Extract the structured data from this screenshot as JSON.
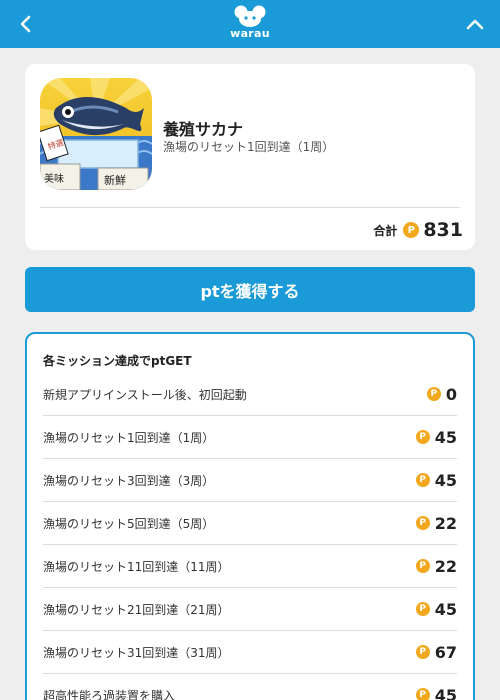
{
  "header": {
    "logo_text": "warau",
    "back_icon": "chevron-left-icon",
    "collapse_icon": "chevron-up-icon"
  },
  "app": {
    "name": "養殖サカナ",
    "subtitle": "漁場のリセット1回到達（1周）",
    "total_label": "合計",
    "total_points": "831",
    "icon_text": [
      "特選",
      "美味",
      "新鮮"
    ]
  },
  "cta": {
    "label": "ptを獲得する"
  },
  "missions": {
    "title": "各ミッション達成でptGET",
    "items": [
      {
        "name": "新規アプリインストール後、初回起動",
        "points": "0"
      },
      {
        "name": "漁場のリセット1回到達（1周）",
        "points": "45"
      },
      {
        "name": "漁場のリセット3回到達（3周）",
        "points": "45"
      },
      {
        "name": "漁場のリセット5回到達（5周）",
        "points": "22"
      },
      {
        "name": "漁場のリセット11回到達（11周）",
        "points": "22"
      },
      {
        "name": "漁場のリセット21回到達（21周）",
        "points": "45"
      },
      {
        "name": "漁場のリセット31回到達（31周）",
        "points": "67"
      },
      {
        "name": "超高性能ろ過装置を購入",
        "points": "45"
      }
    ]
  },
  "coin_symbol": "P",
  "colors": {
    "brand": "#1a9ad6",
    "coin": "#f2a81d",
    "background": "#eeeeee"
  }
}
